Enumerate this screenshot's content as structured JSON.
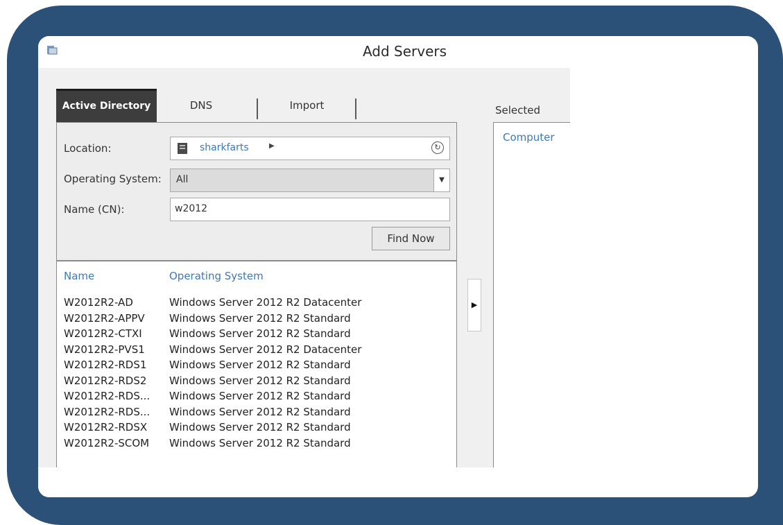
{
  "window": {
    "title": "Add Servers"
  },
  "tabs": [
    {
      "label": "Active Directory",
      "active": true
    },
    {
      "label": "DNS",
      "active": false
    },
    {
      "label": "Import",
      "active": false
    }
  ],
  "search": {
    "location_label": "Location:",
    "location_value": "sharkfarts",
    "os_label": "Operating System:",
    "os_value": "All",
    "name_label": "Name (CN):",
    "name_value": "w2012",
    "find_button": "Find Now"
  },
  "results": {
    "columns": [
      "Name",
      "Operating System"
    ],
    "rows": [
      [
        "W2012R2-AD",
        "Windows Server 2012 R2 Datacenter"
      ],
      [
        "W2012R2-APPV",
        "Windows Server 2012 R2 Standard"
      ],
      [
        "W2012R2-CTXI",
        "Windows Server 2012 R2 Standard"
      ],
      [
        "W2012R2-PVS1",
        "Windows Server 2012 R2 Datacenter"
      ],
      [
        "W2012R2-RDS1",
        "Windows Server 2012 R2 Standard"
      ],
      [
        "W2012R2-RDS2",
        "Windows Server 2012 R2 Standard"
      ],
      [
        "W2012R2-RDS...",
        "Windows Server 2012 R2 Standard"
      ],
      [
        "W2012R2-RDS...",
        "Windows Server 2012 R2 Standard"
      ],
      [
        "W2012R2-RDSX",
        "Windows Server 2012 R2 Standard"
      ],
      [
        "W2012R2-SCOM",
        "Windows Server 2012 R2 Standard"
      ]
    ]
  },
  "selected": {
    "label": "Selected",
    "column": "Computer"
  },
  "icons": {
    "add": "play-arrow-icon",
    "refresh": "refresh-icon",
    "server": "server-icon"
  },
  "colors": {
    "frame": "#2c5178",
    "link": "#3d79b8",
    "active_tab": "#3d3d3d"
  }
}
